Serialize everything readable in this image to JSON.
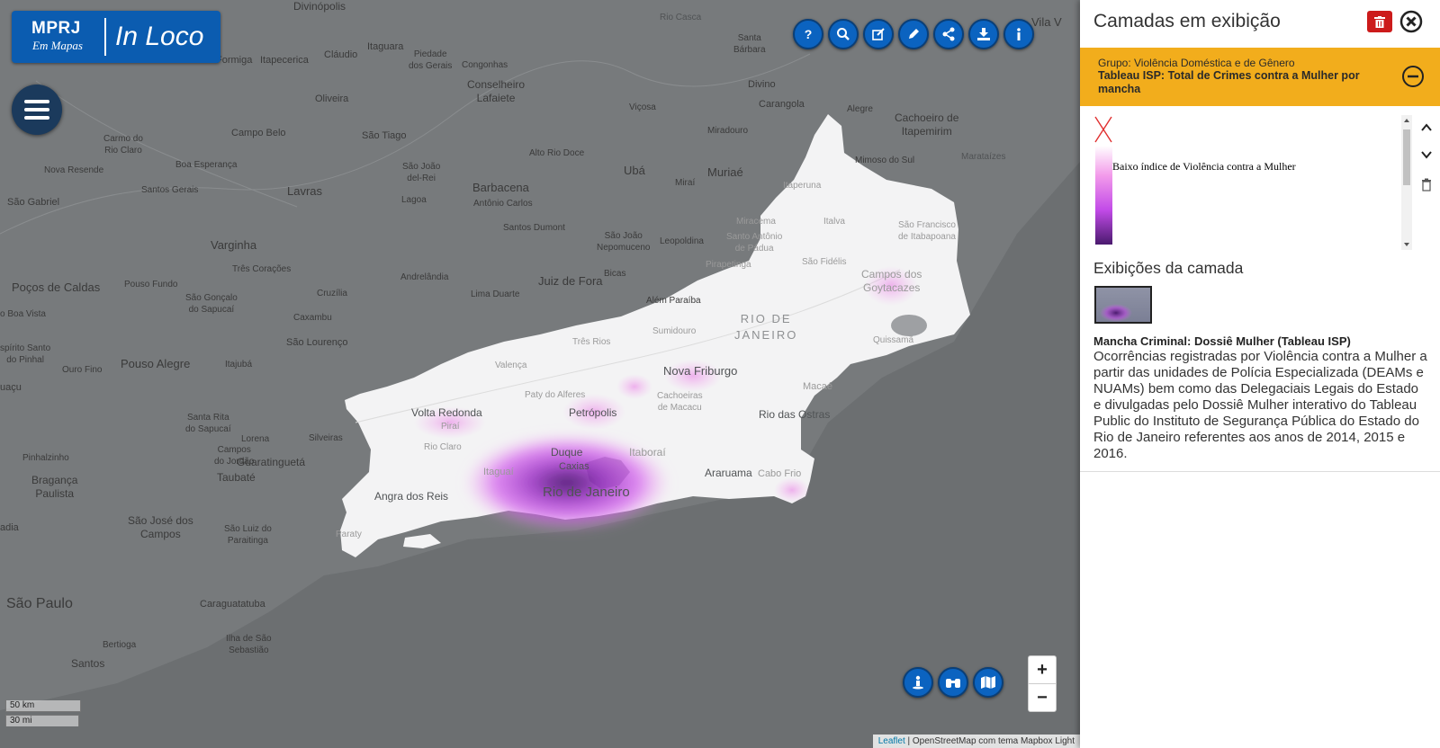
{
  "app": {
    "logo_line1": "MPRJ",
    "logo_line2": "Em Mapas",
    "logo_product": "In Loco"
  },
  "toolbar": {
    "buttons": [
      "help-icon",
      "search-icon",
      "edit-icon",
      "draw-icon",
      "share-icon",
      "download-icon",
      "info-icon"
    ]
  },
  "map": {
    "state_label_line1": "RIO DE",
    "state_label_line2": "JANEIRO",
    "cities": [
      {
        "id": "divinopolis",
        "name": "Divinópolis"
      },
      {
        "id": "rio-casca",
        "name": "Rio Casca"
      },
      {
        "id": "formiga",
        "name": "Formiga"
      },
      {
        "id": "itapecerica",
        "name": "Itapecerica"
      },
      {
        "id": "itaguara",
        "name": "Itaguara"
      },
      {
        "id": "claudio",
        "name": "Cláudio"
      },
      {
        "id": "piedade",
        "name": "Piedade\ndos Gerais"
      },
      {
        "id": "congonhas",
        "name": "Congonhas"
      },
      {
        "id": "santa-barbara",
        "name": "Santa\nBárbara"
      },
      {
        "id": "vila-velha",
        "name": "Vila V"
      },
      {
        "id": "oliveira",
        "name": "Oliveira"
      },
      {
        "id": "conselheiro",
        "name": "Conselheiro\nLafaiete"
      },
      {
        "id": "divino",
        "name": "Divino"
      },
      {
        "id": "carangola",
        "name": "Carangola"
      },
      {
        "id": "vicosa",
        "name": "Viçosa"
      },
      {
        "id": "alegre",
        "name": "Alegre"
      },
      {
        "id": "cachoeiro",
        "name": "Cachoeiro de\nItapemirim"
      },
      {
        "id": "campo-belo",
        "name": "Campo Belo"
      },
      {
        "id": "sao-tiago",
        "name": "São Tiago"
      },
      {
        "id": "miradouro",
        "name": "Miradouro"
      },
      {
        "id": "carmo",
        "name": "Carmo do\nRio Claro"
      },
      {
        "id": "alto-rio-doce",
        "name": "Alto Rio Doce"
      },
      {
        "id": "uba",
        "name": "Ubá"
      },
      {
        "id": "muriae",
        "name": "Muriaé"
      },
      {
        "id": "mimoso",
        "name": "Mimoso do Sul"
      },
      {
        "id": "marataizes",
        "name": "Marataízes"
      },
      {
        "id": "nova-resende",
        "name": "Nova Resende"
      },
      {
        "id": "boa-esperanca",
        "name": "Boa Esperança"
      },
      {
        "id": "sao-joao-del-rei",
        "name": "São João\ndel-Rei"
      },
      {
        "id": "barbacena",
        "name": "Barbacena"
      },
      {
        "id": "mirai",
        "name": "Miraí"
      },
      {
        "id": "itaperuna",
        "name": "Itaperuna"
      },
      {
        "id": "lavras",
        "name": "Lavras"
      },
      {
        "id": "santos-gerais",
        "name": "Santos Gerais"
      },
      {
        "id": "antonio-carlos",
        "name": "Antônio Carlos"
      },
      {
        "id": "sao-gabriel",
        "name": "São Gabriel"
      },
      {
        "id": "lagoa",
        "name": "Lagoa"
      },
      {
        "id": "miracema",
        "name": "Miracema"
      },
      {
        "id": "italva",
        "name": "Italva"
      },
      {
        "id": "santos-dumont",
        "name": "Santos Dumont"
      },
      {
        "id": "sao-joao-nepomuceno",
        "name": "São João\nNepomuceno"
      },
      {
        "id": "leopoldina",
        "name": "Leopoldina"
      },
      {
        "id": "santo-antonio-padua",
        "name": "Santo Antônio\nde Pádua"
      },
      {
        "id": "sao-francisco",
        "name": "São Francisco\nde Itabapoana"
      },
      {
        "id": "varginha",
        "name": "Varginha"
      },
      {
        "id": "tres-coracoes",
        "name": "Três Corações"
      },
      {
        "id": "andrelandia",
        "name": "Andrelândia"
      },
      {
        "id": "bicas",
        "name": "Bicas"
      },
      {
        "id": "pirapetinga",
        "name": "Pirapetinga"
      },
      {
        "id": "sao-fidelis",
        "name": "São Fidélis"
      },
      {
        "id": "campos",
        "name": "Campos dos\nGoytacazes"
      },
      {
        "id": "pocos",
        "name": "Poços de Caldas"
      },
      {
        "id": "pouso-fundo",
        "name": "Pouso Fundo"
      },
      {
        "id": "juiz-de-fora",
        "name": "Juiz de Fora"
      },
      {
        "id": "cruzilia",
        "name": "Cruzília"
      },
      {
        "id": "sao-goncalo-sapucai",
        "name": "São Gonçalo\ndo Sapucaí"
      },
      {
        "id": "lima-duarte",
        "name": "Lima Duarte"
      },
      {
        "id": "alem-paraiba",
        "name": "Além Paraíba"
      },
      {
        "id": "boa-vista",
        "name": "o Boa Vista"
      },
      {
        "id": "caxambu",
        "name": "Caxambu"
      },
      {
        "id": "sumidouro",
        "name": "Sumidouro"
      },
      {
        "id": "quissama",
        "name": "Quissamã"
      },
      {
        "id": "sao-lourenco",
        "name": "São Lourenço"
      },
      {
        "id": "tres-rios",
        "name": "Três Rios"
      },
      {
        "id": "espirito-pinhal",
        "name": "spírito Santo\ndo Pinhal"
      },
      {
        "id": "pouso-alegre",
        "name": "Pouso Alegre"
      },
      {
        "id": "itajuba",
        "name": "Itajubá"
      },
      {
        "id": "valenca",
        "name": "Valença"
      },
      {
        "id": "nova-friburgo",
        "name": "Nova Friburgo"
      },
      {
        "id": "ouro-fino",
        "name": "Ouro Fino"
      },
      {
        "id": "macae",
        "name": "Macaé"
      },
      {
        "id": "paty",
        "name": "Paty do Alferes"
      },
      {
        "id": "cachoeiras",
        "name": "Cachoeiras\nde Macacu"
      },
      {
        "id": "guacu",
        "name": "uaçu"
      },
      {
        "id": "volta-redonda",
        "name": "Volta Redonda"
      },
      {
        "id": "petropolis",
        "name": "Petrópolis"
      },
      {
        "id": "rio-das-ostras",
        "name": "Rio das Ostras"
      },
      {
        "id": "santa-rita",
        "name": "Santa Rita\ndo Sapucaí"
      },
      {
        "id": "silveiras",
        "name": "Silveiras"
      },
      {
        "id": "piraí",
        "name": "Piraí"
      },
      {
        "id": "lorena",
        "name": "Lorena"
      },
      {
        "id": "campos-jordao",
        "name": "Campos\ndo Jordão"
      },
      {
        "id": "rio-claro",
        "name": "Rio Claro"
      },
      {
        "id": "duque",
        "name": "Duque"
      },
      {
        "id": "itaborai",
        "name": "Itaboraí"
      },
      {
        "id": "pinhalzinho",
        "name": "Pinhalzinho"
      },
      {
        "id": "guaratingueta",
        "name": "Guaratinguetá"
      },
      {
        "id": "caxias",
        "name": "Caxias"
      },
      {
        "id": "itaguai",
        "name": "Itaguaí"
      },
      {
        "id": "araruama",
        "name": "Araruama"
      },
      {
        "id": "cabo-frio",
        "name": "Cabo Frio"
      },
      {
        "id": "braganca",
        "name": "Bragança\nPaulista"
      },
      {
        "id": "taubate",
        "name": "Taubaté"
      },
      {
        "id": "angra",
        "name": "Angra dos Reis"
      },
      {
        "id": "rio-de-janeiro",
        "name": "Rio de Janeiro"
      },
      {
        "id": "sao-jose-campos",
        "name": "São José dos\nCampos"
      },
      {
        "id": "sao-luiz",
        "name": "São Luiz do\nParaitinga"
      },
      {
        "id": "paraty",
        "name": "Paraty"
      },
      {
        "id": "adia",
        "name": "adia"
      },
      {
        "id": "sao-paulo",
        "name": "São Paulo"
      },
      {
        "id": "caraguatatuba",
        "name": "Caraguatatuba"
      },
      {
        "id": "bertioga",
        "name": "Bertioga"
      },
      {
        "id": "ilha-sao-sebastiao",
        "name": "Ilha de São\nSebastião"
      },
      {
        "id": "santos",
        "name": "Santos"
      }
    ],
    "scale_km": "50 km",
    "scale_mi": "30 mi",
    "attribution_link": "Leaflet",
    "attribution_text": " | OpenStreetMap com tema Mapbox Light",
    "zoom_in": "+",
    "zoom_out": "−",
    "colors": {
      "land": "#f3f3f4",
      "outside": "#6b6e70",
      "heat_low": "#f7a6f2",
      "heat_mid": "#d35bee",
      "heat_high": "#4a1a6e"
    }
  },
  "panel": {
    "title": "Camadas em exibição",
    "group_label": "Grupo: Violência Doméstica e de Gênero",
    "layer_name": "Tableau ISP: Total de Crimes contra a Mulher por mancha",
    "legend_label": "Baixo índice de Violência contra a Mulher",
    "exhibitions_title": "Exibições da camada",
    "description_title": "Mancha Criminal: Dossiê Mulher (Tableau ISP)",
    "description_text": "Ocorrências registradas por Violência contra a Mulher a partir das unidades de Polícia Especializada (DEAMs e NUAMs) bem como das Delegaciais Legais do Estado e divulgadas pelo Dossiê Mulher interativo do Tableau Public do Instituto de Segurança Pública do Estado do Rio de Janeiro referentes aos anos de 2014, 2015 e 2016."
  }
}
